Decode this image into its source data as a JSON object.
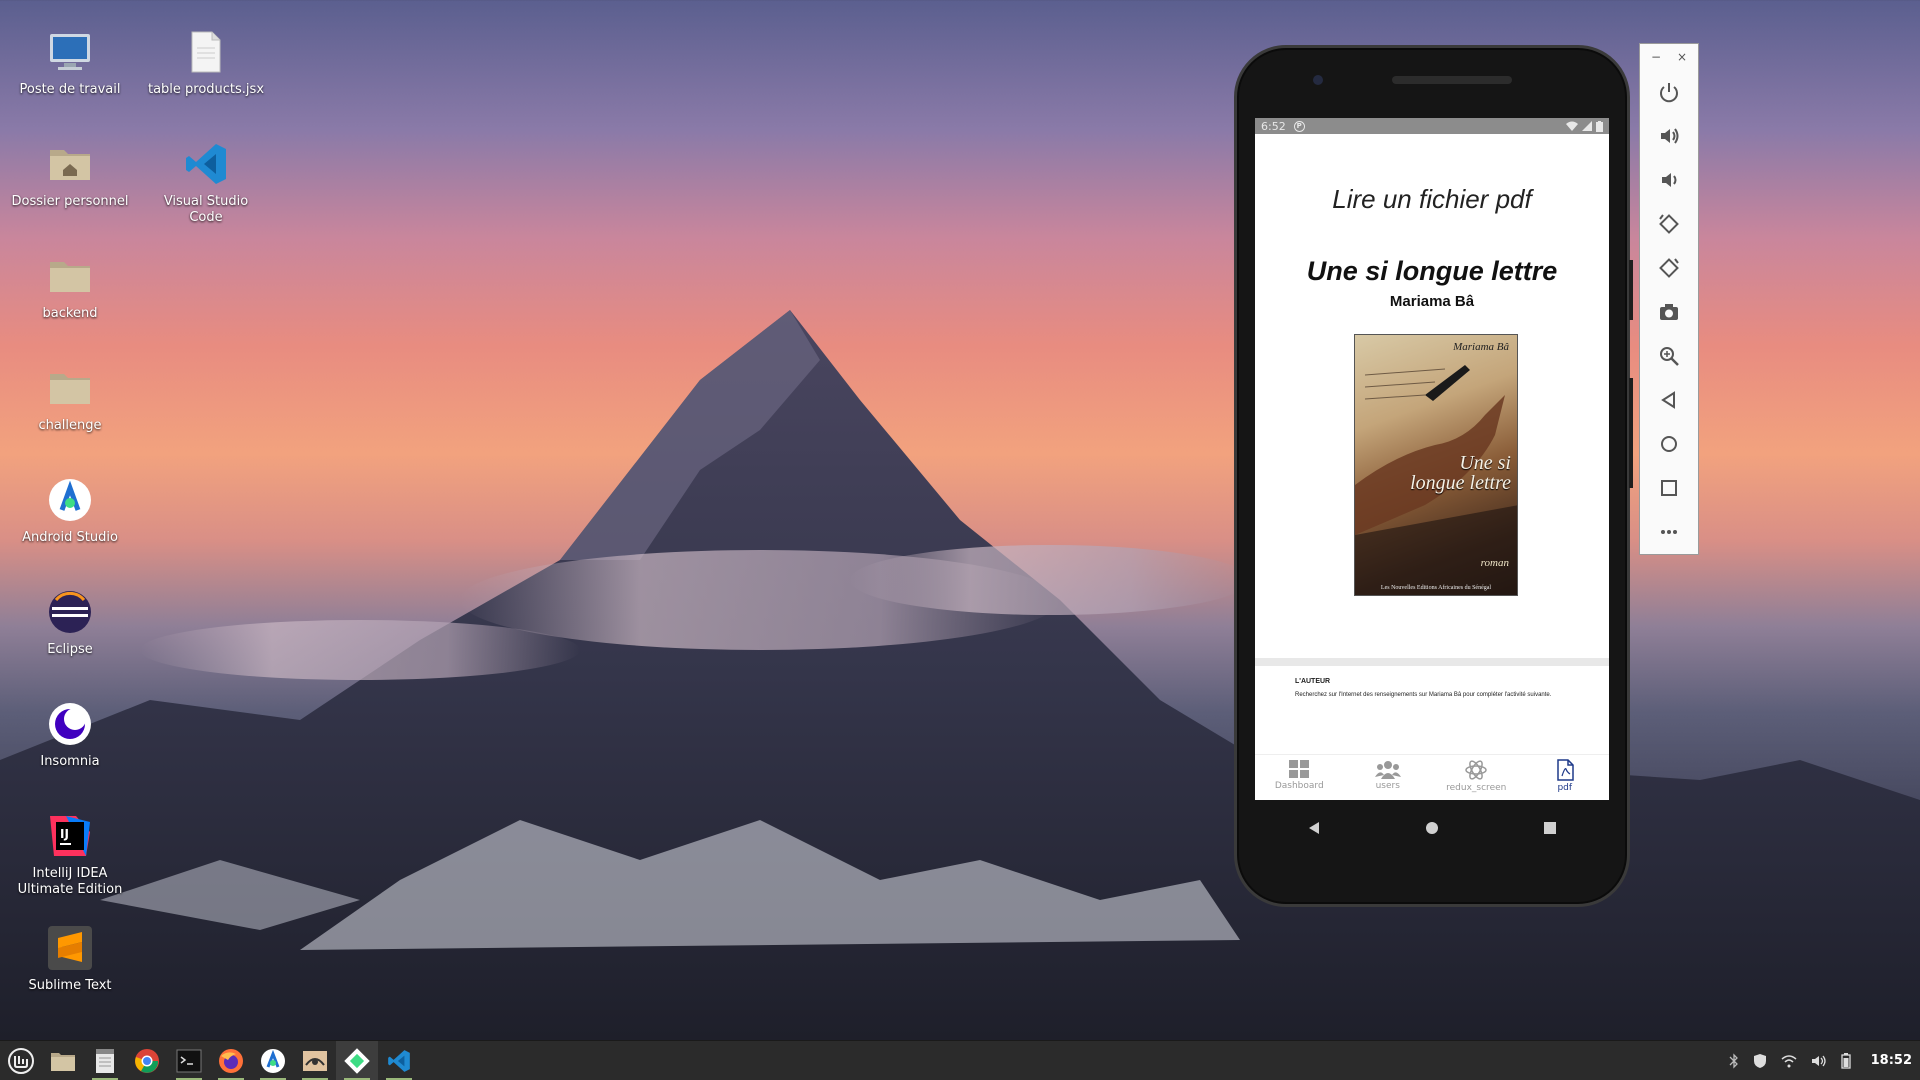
{
  "desktop": {
    "icons": [
      {
        "label": "Poste de travail",
        "icon": "computer-icon"
      },
      {
        "label": "table products.jsx",
        "icon": "file-icon"
      },
      {
        "label": "Dossier personnel",
        "icon": "home-folder-icon"
      },
      {
        "label": "Visual Studio Code",
        "icon": "vscode-icon"
      },
      {
        "label": "backend",
        "icon": "folder-icon"
      },
      {
        "label": "challenge",
        "icon": "folder-icon"
      },
      {
        "label": "Android Studio",
        "icon": "android-studio-icon"
      },
      {
        "label": "Eclipse",
        "icon": "eclipse-icon"
      },
      {
        "label": "Insomnia",
        "icon": "insomnia-icon"
      },
      {
        "label": "IntelliJ IDEA Ultimate Edition",
        "icon": "intellij-icon"
      },
      {
        "label": "Sublime Text",
        "icon": "sublime-icon"
      }
    ]
  },
  "phone": {
    "status_time": "6:52",
    "app_title": "Lire un fichier pdf",
    "pdf": {
      "book_title": "Une si longue lettre",
      "book_author": "Mariama Bâ",
      "cover_author": "Mariama Bâ",
      "cover_title": "Une si longue lettre",
      "cover_genre": "roman",
      "cover_publisher": "Les Nouvelles Editions Africaines du Sénégal",
      "page2_heading": "L'AUTEUR",
      "page2_text": "Recherchez sur l'Internet des renseignements sur Mariama Bâ pour compléter l'activité suivante."
    },
    "bottom_nav": [
      {
        "label": "Dashboard",
        "icon": "dashboard-icon",
        "active": false
      },
      {
        "label": "users",
        "icon": "users-icon",
        "active": false
      },
      {
        "label": "redux_screen",
        "icon": "redux-icon",
        "active": false
      },
      {
        "label": "pdf",
        "icon": "pdf-icon",
        "active": true
      }
    ]
  },
  "emulator_toolbar": {
    "window_controls": [
      "−",
      "×"
    ],
    "buttons": [
      "power-icon",
      "volume-up-icon",
      "volume-down-icon",
      "rotate-left-icon",
      "rotate-right-icon",
      "camera-icon",
      "zoom-icon",
      "back-icon",
      "home-icon",
      "overview-icon",
      "more-icon"
    ]
  },
  "taskbar": {
    "clock": "18:52"
  }
}
